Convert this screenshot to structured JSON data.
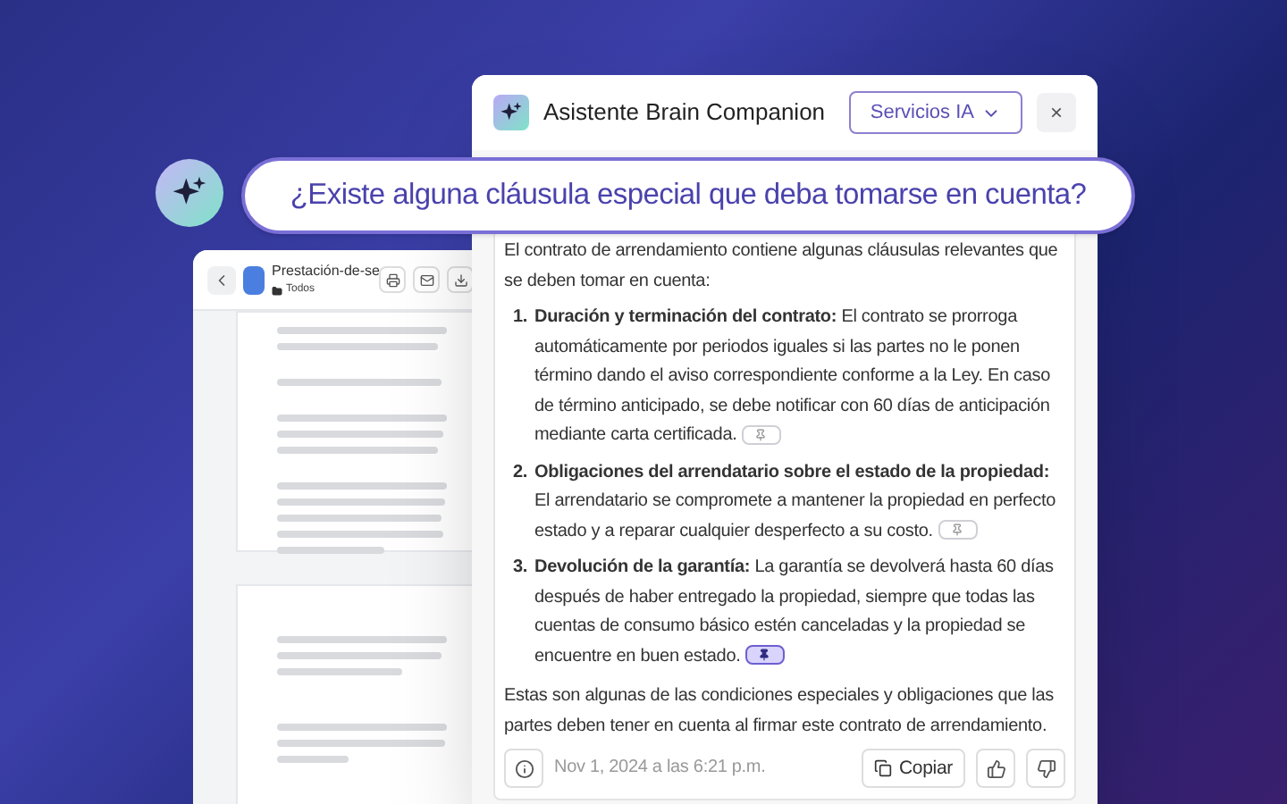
{
  "document": {
    "file_name": "Prestación-de-se",
    "folder": "Todos"
  },
  "assistant": {
    "title": "Asistente Brain Companion",
    "dropdown": "Servicios IA",
    "close": "×"
  },
  "question": "¿Existe alguna cláusula especial que deba tomarse en cuenta?",
  "answer": {
    "intro": "El contrato de arrendamiento contiene algunas cláusulas relevantes que se deben tomar en cuenta:",
    "items": [
      {
        "number": "1.",
        "text": "**Duración y terminación del contrato:** El contrato se prorroga automáticamente por periodos iguales si las partes no le ponen término dando el aviso correspondiente conforme a la Ley. En caso de término anticipado, se debe notificar con 60 días de anticipación mediante carta certificada.",
        "selected": false
      },
      {
        "number": "2.",
        "text": "**Obligaciones del arrendatario sobre el estado de la propiedad:** El arrendatario se compromete a mantener la propiedad en perfecto estado y a reparar cualquier desperfecto a su costo.",
        "selected": false
      },
      {
        "number": "3.",
        "text": "**Devolución de la garantía:** La garantía se devolverá hasta 60 días después de haber entregado la propiedad, siempre que todas las cuentas de consumo básico estén canceladas y la propiedad se encuentre en buen estado.",
        "selected": true
      }
    ],
    "outro": "Estas son algunas de las condiciones especiales y obligaciones que las partes deben tener en cuenta al firmar este contrato de arrendamiento.",
    "timestamp": "Nov 1, 2024 a las 6:21 p.m.",
    "copy": "Copiar"
  }
}
